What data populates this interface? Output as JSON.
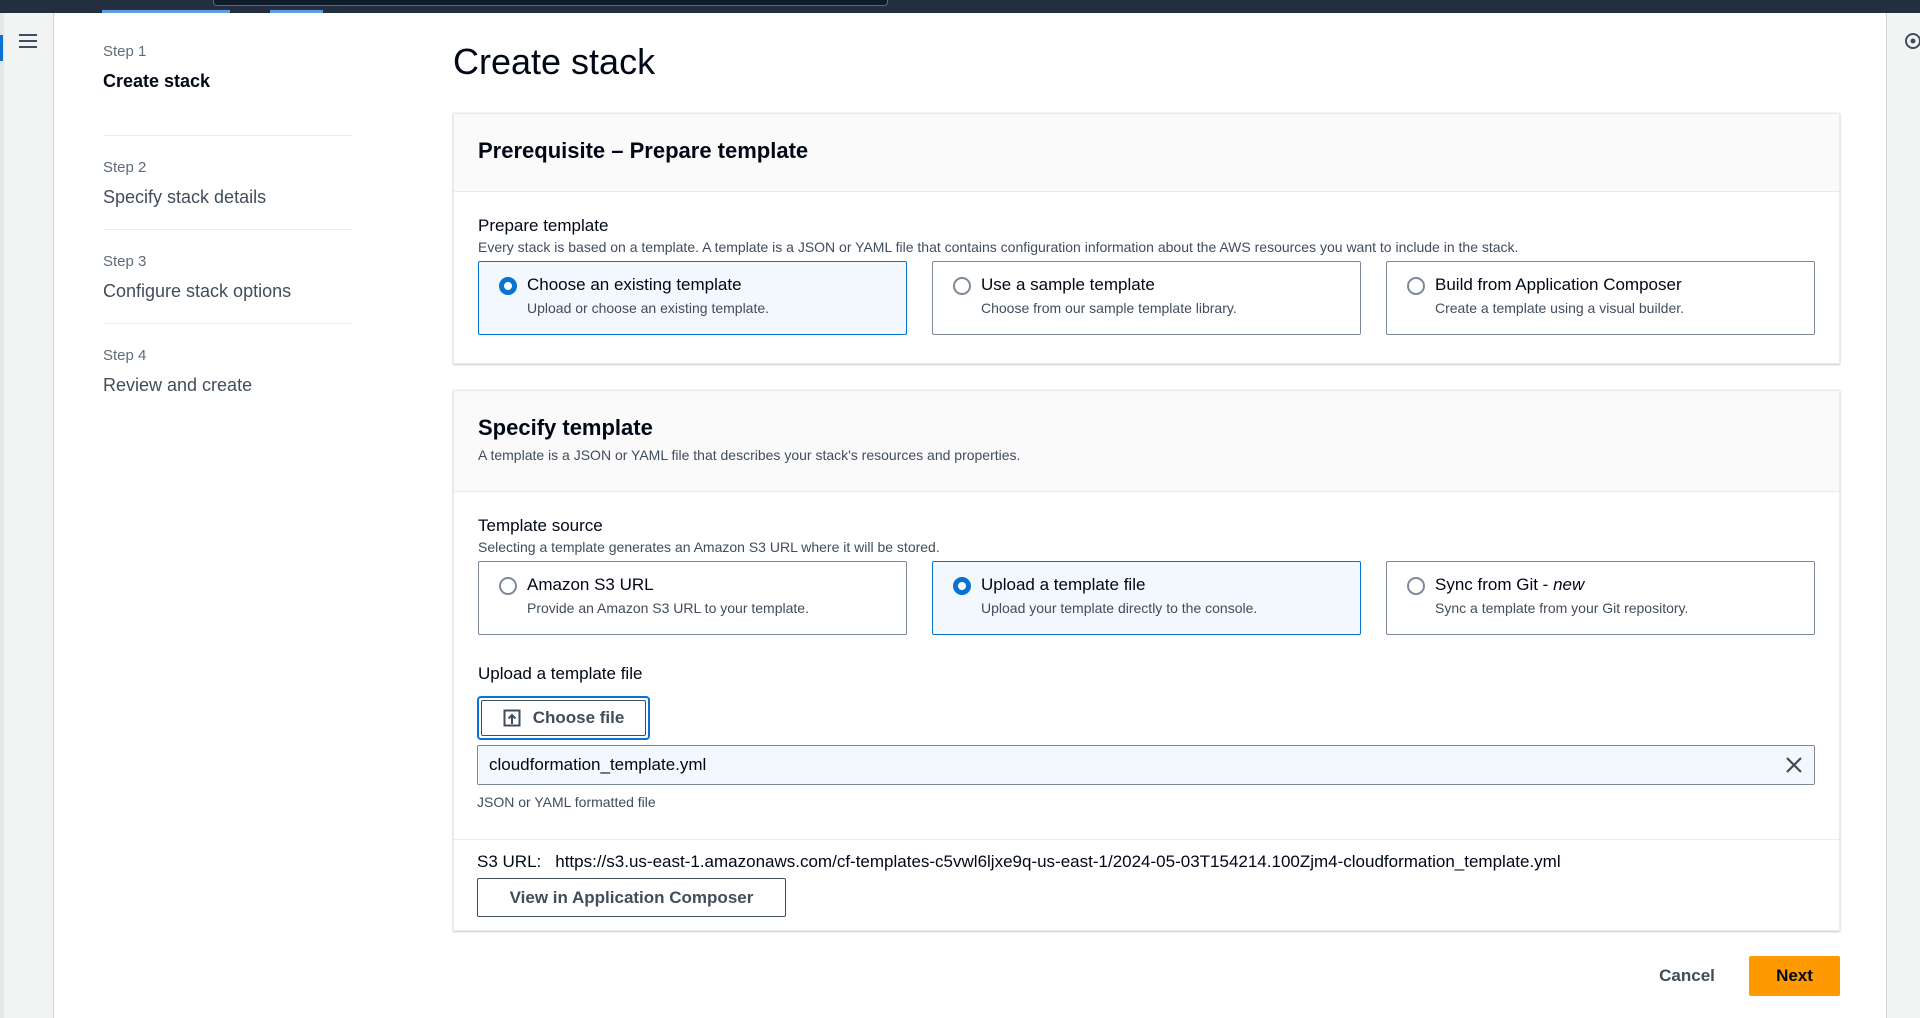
{
  "wizard_steps": [
    {
      "num": "Step 1",
      "title": "Create stack"
    },
    {
      "num": "Step 2",
      "title": "Specify stack details"
    },
    {
      "num": "Step 3",
      "title": "Configure stack options"
    },
    {
      "num": "Step 4",
      "title": "Review and create"
    }
  ],
  "page": {
    "title": "Create stack"
  },
  "prepare": {
    "panel_title": "Prerequisite – Prepare template",
    "field_label": "Prepare template",
    "field_desc": "Every stack is based on a template. A template is a JSON or YAML file that contains configuration information about the AWS resources you want to include in the stack.",
    "options": [
      {
        "title": "Choose an existing template",
        "desc": "Upload or choose an existing template.",
        "selected": true
      },
      {
        "title": "Use a sample template",
        "desc": "Choose from our sample template library.",
        "selected": false
      },
      {
        "title": "Build from Application Composer",
        "desc": "Create a template using a visual builder.",
        "selected": false
      }
    ]
  },
  "specify": {
    "panel_title": "Specify template",
    "panel_desc": "A template is a JSON or YAML file that describes your stack's resources and properties.",
    "source_label": "Template source",
    "source_desc": "Selecting a template generates an Amazon S3 URL where it will be stored.",
    "options": [
      {
        "title": "Amazon S3 URL",
        "desc": "Provide an Amazon S3 URL to your template.",
        "selected": false
      },
      {
        "title": "Upload a template file",
        "desc": "Upload your template directly to the console.",
        "selected": true
      },
      {
        "title": "Sync from Git - ",
        "title_em": "new",
        "desc": "Sync a template from your Git repository.",
        "selected": false
      }
    ],
    "upload_label": "Upload a template file",
    "choose_file_label": "Choose file",
    "file_name": "cloudformation_template.yml",
    "file_hint": "JSON or YAML formatted file",
    "s3_label": "S3 URL:",
    "s3_url": "https://s3.us-east-1.amazonaws.com/cf-templates-c5vwl6ljxe9q-us-east-1/2024-05-03T154214.100Zjm4-cloudformation_template.yml",
    "view_composer_label": "View in Application Composer"
  },
  "footer": {
    "cancel_label": "Cancel",
    "next_label": "Next"
  },
  "colors": {
    "accent": "#0972d3",
    "primary_button": "#ff9900",
    "topbar": "#232f3e"
  },
  "icons": {
    "menu": "hamburger-menu-icon",
    "upload": "upload-icon",
    "clear": "close-icon",
    "right_rail": "settings-icon"
  }
}
